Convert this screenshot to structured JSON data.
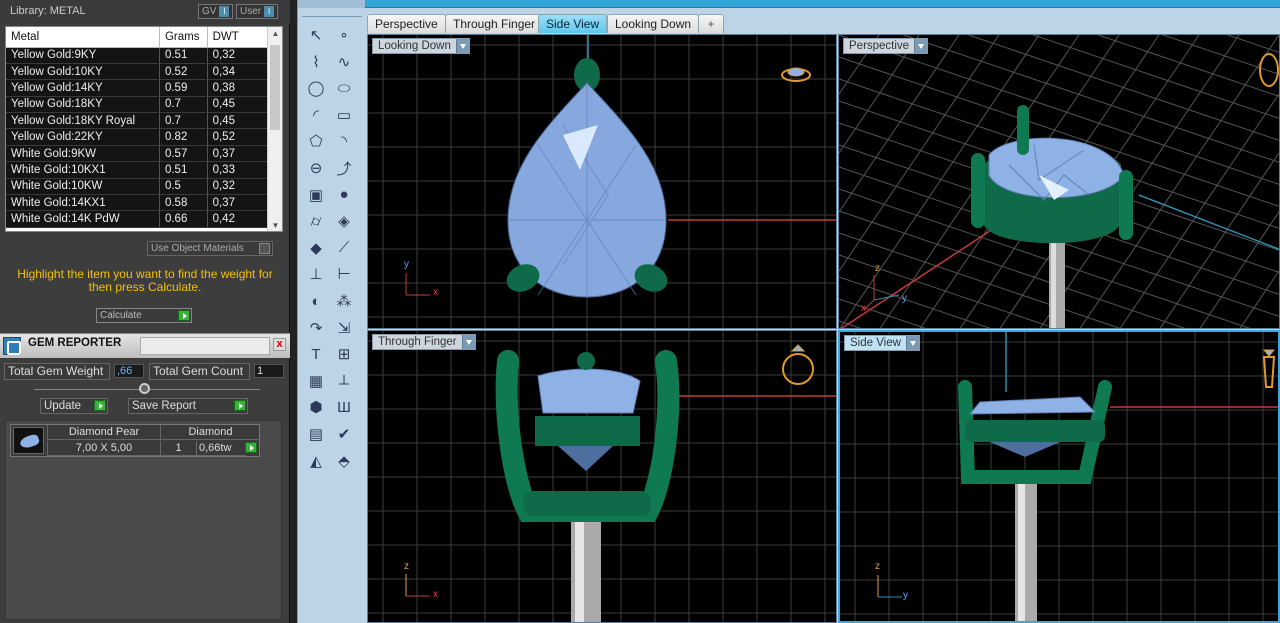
{
  "library": {
    "title": "Library: METAL",
    "gv_label": "GV",
    "user_label": "User",
    "toggle_glyph": "I",
    "columns": [
      "Metal",
      "Grams",
      "DWT"
    ],
    "rows": [
      [
        "Yellow Gold:9KY",
        "0.51",
        "0,32"
      ],
      [
        "Yellow Gold:10KY",
        "0.52",
        "0,34"
      ],
      [
        "Yellow Gold:14KY",
        "0.59",
        "0,38"
      ],
      [
        "Yellow Gold:18KY",
        "0.7",
        "0,45"
      ],
      [
        "Yellow Gold:18KY Royal",
        "0.7",
        "0,45"
      ],
      [
        "Yellow Gold:22KY",
        "0.82",
        "0,52"
      ],
      [
        "White Gold:9KW",
        "0.57",
        "0,37"
      ],
      [
        "White Gold:10KX1",
        "0.51",
        "0,33"
      ],
      [
        "White Gold:10KW",
        "0.5",
        "0,32"
      ],
      [
        "White Gold:14KX1",
        "0.58",
        "0,37"
      ],
      [
        "White Gold:14K PdW",
        "0.66",
        "0,42"
      ]
    ],
    "use_object_materials": "Use Object Materials",
    "hint": "Highlight the item you want to find the weight for then press Calculate.",
    "calculate": "Calculate"
  },
  "gem_reporter": {
    "title": "GEM REPORTER",
    "close_glyph": "x",
    "total_weight_label": "Total Gem Weight",
    "total_weight_value": ",66",
    "total_count_label": "Total Gem Count",
    "total_count_value": "1",
    "update": "Update",
    "save_report": "Save Report",
    "gem": {
      "name": "Diamond Pear",
      "type": "Diamond",
      "size": "7,00 X 5,00",
      "count": "1",
      "weight": "0,66tw"
    }
  },
  "tabs": [
    "Perspective",
    "Through Finger",
    "Side View",
    "Looking Down"
  ],
  "active_tab": "Side View",
  "add_tab_glyph": "+",
  "viewports": {
    "top_left": {
      "label": "Looking Down",
      "axis1": "y",
      "axis2": "x"
    },
    "top_right": {
      "label": "Perspective",
      "axis1": "z",
      "axis2": "y",
      "axis3": "x"
    },
    "bottom_left": {
      "label": "Through Finger",
      "axis1": "z",
      "axis2": "x"
    },
    "bottom_right": {
      "label": "Side View",
      "axis1": "z",
      "axis2": "y"
    }
  },
  "tools": [
    "select-arrow-icon",
    "point-icon",
    "polyline-icon",
    "curve-icon",
    "circle-icon",
    "ellipse-icon",
    "arc-icon",
    "rectangle-icon",
    "polygon-icon",
    "fillet-icon",
    "offset-icon",
    "extend-icon",
    "box-icon",
    "sphere-icon",
    "cylinder-icon",
    "surface-icon",
    "gem-icon",
    "cutter-icon",
    "trim-icon",
    "join-icon",
    "boolean-icon",
    "explode-icon",
    "move-icon",
    "scale-icon",
    "text-icon",
    "array-icon",
    "grid-icon",
    "measure-icon",
    "solid-icon",
    "analyze-icon",
    "layer-icon",
    "check-icon",
    "render-icon",
    "material-icon"
  ],
  "colors": {
    "gem": "#8fb2e6",
    "setting": "#0f6b4a",
    "grid": "#3b3b3b",
    "x_axis": "#c43a3a",
    "y_axis": "#2f8fb0",
    "accent": "#33a6d8",
    "hint": "#f2c200"
  }
}
